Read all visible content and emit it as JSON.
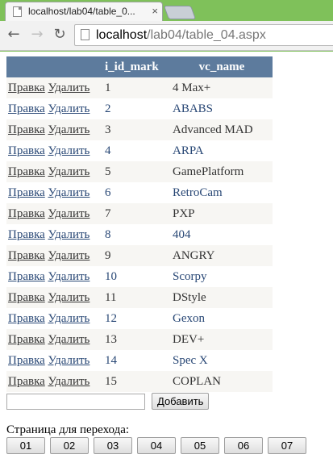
{
  "browser": {
    "tab_title": "localhost/lab04/table_0...",
    "tab_close": "×",
    "back_glyph": "←",
    "forward_glyph": "→",
    "reload_glyph": "↻",
    "url_host": "localhost",
    "url_path": "/lab04/table_04.aspx",
    "frame_color": "#7fc15a"
  },
  "table": {
    "headers": [
      "",
      "i_id_mark",
      "vc_name"
    ],
    "header_color": "#5d7b9d",
    "edit_label": "Правка",
    "delete_label": "Удалить",
    "rows": [
      {
        "id": "1",
        "name": "4 Max+"
      },
      {
        "id": "2",
        "name": "ABABS"
      },
      {
        "id": "3",
        "name": "Advanced MAD"
      },
      {
        "id": "4",
        "name": "ARPA"
      },
      {
        "id": "5",
        "name": "GamePlatform"
      },
      {
        "id": "6",
        "name": "RetroCam"
      },
      {
        "id": "7",
        "name": "PXP"
      },
      {
        "id": "8",
        "name": "404"
      },
      {
        "id": "9",
        "name": "ANGRY"
      },
      {
        "id": "10",
        "name": "Scorpy"
      },
      {
        "id": "11",
        "name": "DStyle"
      },
      {
        "id": "12",
        "name": "Gexon"
      },
      {
        "id": "13",
        "name": "DEV+"
      },
      {
        "id": "14",
        "name": "Spec X"
      },
      {
        "id": "15",
        "name": "COPLAN"
      }
    ]
  },
  "add_form": {
    "input_value": "",
    "button_label": "Добавить"
  },
  "pager": {
    "label": "Страница для перехода:",
    "pages": [
      "01",
      "02",
      "03",
      "04",
      "05",
      "06",
      "07"
    ]
  }
}
